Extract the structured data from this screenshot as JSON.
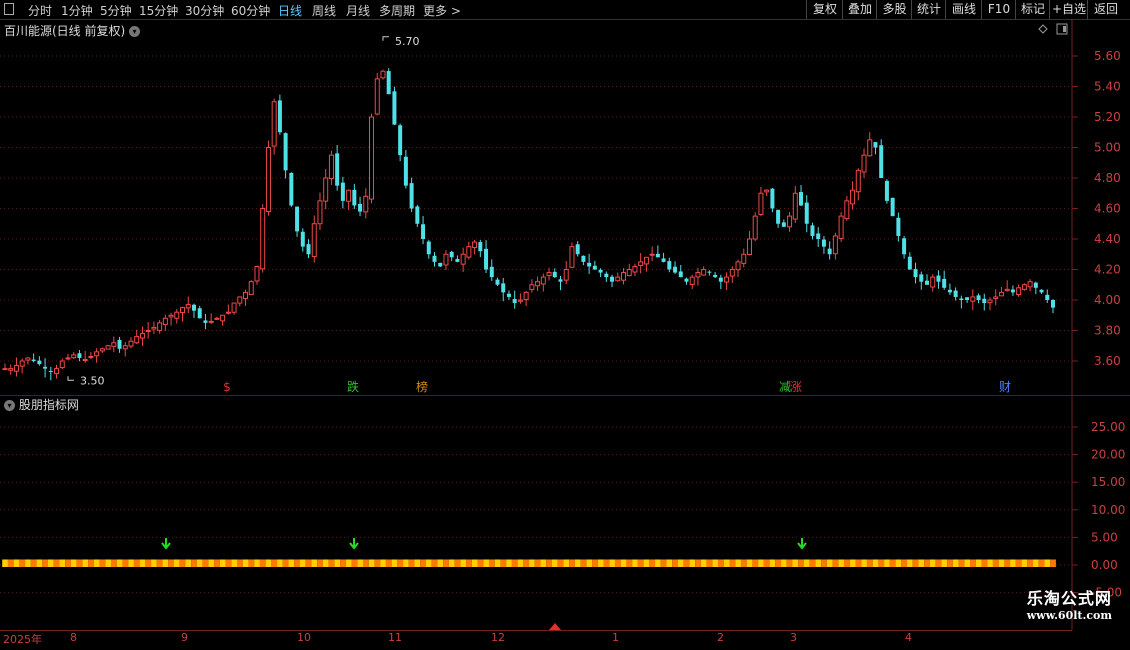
{
  "toolbar": {
    "periods": [
      "分时",
      "1分钟",
      "5分钟",
      "15分钟",
      "30分钟",
      "60分钟",
      "日线",
      "周线",
      "月线",
      "多周期",
      "更多 >"
    ],
    "active_period": "日线",
    "buttons": [
      "复权",
      "叠加",
      "多股",
      "统计",
      "画线",
      "F10",
      "标记",
      "+自选",
      "返回"
    ]
  },
  "main": {
    "title": "百川能源(日线 前复权)",
    "high_label": "5.70",
    "low_label": "3.50",
    "event_markers": [
      {
        "text": "$",
        "color": "#e03030"
      },
      {
        "text": "跌",
        "color": "#30c030"
      },
      {
        "text": "榜",
        "color": "#d08a20"
      },
      {
        "text": "减",
        "color": "#30c030"
      },
      {
        "text": "涨",
        "color": "#e03030"
      },
      {
        "text": "财",
        "color": "#4a80ff"
      }
    ],
    "price_axis": [
      "5.60",
      "5.40",
      "5.20",
      "5.00",
      "4.80",
      "4.60",
      "4.40",
      "4.20",
      "4.00",
      "3.80",
      "3.60"
    ]
  },
  "sub": {
    "title": "股朋指标网",
    "value_axis": [
      "25.00",
      "20.00",
      "15.00",
      "10.00",
      "5.00",
      "0.00",
      "-5.00"
    ],
    "bar_value": 1,
    "arrow_count": 3
  },
  "date_axis": {
    "labels": [
      "2025年",
      "8",
      "9",
      "10",
      "11",
      "12",
      "1",
      "2",
      "3",
      "4"
    ]
  },
  "watermark": {
    "cn": "乐淘公式网",
    "url": "www.60lt.com"
  },
  "colors": {
    "up": "#f04848",
    "down": "#50e0e8",
    "grid": "#5a1818",
    "axis_text": "#c84040",
    "bar_a": "#ffd000",
    "bar_b": "#ff7a00"
  },
  "chart_data": {
    "type": "candlestick",
    "yrange": [
      3.45,
      5.75
    ],
    "series": [
      {
        "name": "price_path",
        "values": [
          3.55,
          3.55,
          3.57,
          3.6,
          3.62,
          3.6,
          3.58,
          3.55,
          3.53,
          3.55,
          3.6,
          3.62,
          3.64,
          3.62,
          3.61,
          3.63,
          3.66,
          3.68,
          3.7,
          3.72,
          3.68,
          3.7,
          3.73,
          3.76,
          3.78,
          3.8,
          3.82,
          3.85,
          3.88,
          3.9,
          3.92,
          3.95,
          3.97,
          3.93,
          3.88,
          3.85,
          3.86,
          3.88,
          3.9,
          3.92,
          3.98,
          4.02,
          4.05,
          4.12,
          4.22,
          4.6,
          5.0,
          5.3,
          5.1,
          4.85,
          4.62,
          4.45,
          4.35,
          4.3,
          4.5,
          4.65,
          4.8,
          4.95,
          4.75,
          4.65,
          4.72,
          4.62,
          4.58,
          4.68,
          5.2,
          5.45,
          5.5,
          5.35,
          5.15,
          4.95,
          4.75,
          4.6,
          4.5,
          4.4,
          4.3,
          4.25,
          4.22,
          4.3,
          4.28,
          4.25,
          4.3,
          4.35,
          4.38,
          4.32,
          4.2,
          4.15,
          4.1,
          4.05,
          4.02,
          3.98,
          4.0,
          4.05,
          4.1,
          4.12,
          4.15,
          4.18,
          4.15,
          4.12,
          4.2,
          4.35,
          4.3,
          4.25,
          4.22,
          4.2,
          4.18,
          4.15,
          4.12,
          4.15,
          4.18,
          4.2,
          4.22,
          4.25,
          4.28,
          4.3,
          4.28,
          4.25,
          4.2,
          4.18,
          4.15,
          4.12,
          4.15,
          4.18,
          4.2,
          4.18,
          4.15,
          4.12,
          4.15,
          4.2,
          4.25,
          4.3,
          4.4,
          4.55,
          4.7,
          4.72,
          4.6,
          4.5,
          4.48,
          4.55,
          4.7,
          4.62,
          4.5,
          4.42,
          4.4,
          4.35,
          4.3,
          4.42,
          4.55,
          4.65,
          4.72,
          4.85,
          4.95,
          5.05,
          5.0,
          4.8,
          4.65,
          4.55,
          4.42,
          4.3,
          4.2,
          4.15,
          4.12,
          4.1,
          4.15,
          4.12,
          4.08,
          4.05,
          4.02,
          4.0,
          4.0,
          4.02,
          4.0,
          3.98,
          4.0,
          4.02,
          4.05,
          4.07,
          4.05,
          4.08,
          4.1,
          4.12,
          4.08,
          4.05,
          4.0,
          3.95
        ]
      }
    ]
  }
}
